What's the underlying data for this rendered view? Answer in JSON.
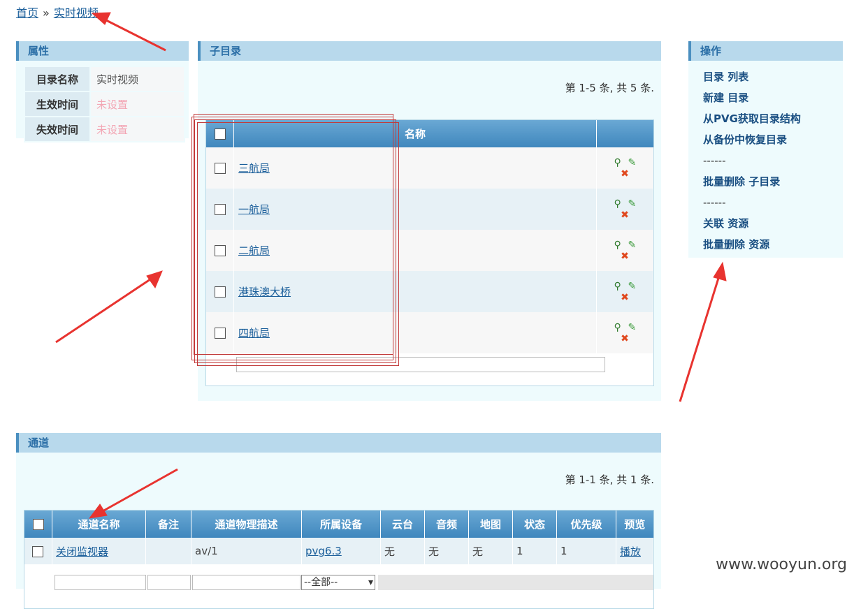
{
  "breadcrumb": {
    "home": "首页",
    "separator": "»",
    "current": "实时视频"
  },
  "properties": {
    "title": "属性",
    "rows": [
      {
        "key": "目录名称",
        "value": "实时视频"
      },
      {
        "key": "生效时间",
        "value": "未设置"
      },
      {
        "key": "失效时间",
        "value": "未设置"
      }
    ]
  },
  "subdirectory": {
    "title": "子目录",
    "pager": "第 1-5 条, 共 5 条.",
    "header_name": "名称",
    "rows": [
      "三航局",
      "一航局",
      "二航局",
      "港珠澳大桥",
      "四航局"
    ]
  },
  "operations": {
    "title": "操作",
    "items": [
      "目录 列表",
      "新建 目录",
      "从PVG获取目录结构",
      "从备份中恢复目录",
      "------",
      "批量删除 子目录",
      "------",
      "关联 资源",
      "批量删除 资源"
    ]
  },
  "channel": {
    "title": "通道",
    "pager": "第 1-1 条, 共 1 条.",
    "headers": [
      "通道名称",
      "备注",
      "通道物理描述",
      "所属设备",
      "云台",
      "音频",
      "地图",
      "状态",
      "优先级",
      "预览"
    ],
    "row": [
      "关闭监视器",
      "",
      "av/1",
      "pvg6.3",
      "无",
      "无",
      "无",
      "1",
      "1",
      "播放"
    ],
    "filter_select": "--全部--"
  },
  "watermark": "www.wooyun.org",
  "colors": {
    "header_bg": "#b8d9ec",
    "body_bg": "#eefbfd",
    "link": "#1a5e9a",
    "arrow": "#e8332f"
  }
}
